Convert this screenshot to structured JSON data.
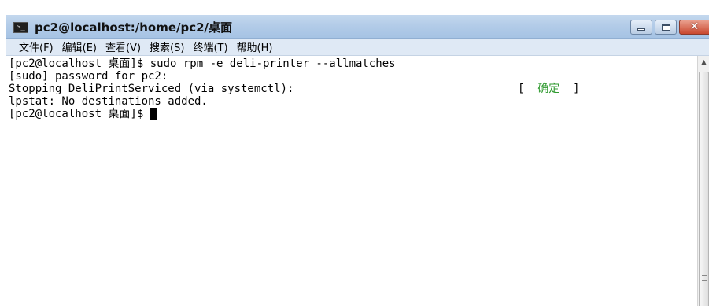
{
  "window": {
    "title": "pc2@localhost:/home/pc2/桌面",
    "icon": "terminal-icon",
    "controls": {
      "minimize": "minimize-icon",
      "maximize": "maximize-icon",
      "close": "close-icon",
      "close_glyph": "✕"
    }
  },
  "menubar": {
    "items": [
      {
        "label": "文件(F)"
      },
      {
        "label": "编辑(E)"
      },
      {
        "label": "查看(V)"
      },
      {
        "label": "搜索(S)"
      },
      {
        "label": "终端(T)"
      },
      {
        "label": "帮助(H)"
      }
    ]
  },
  "terminal": {
    "lines": [
      "[pc2@localhost 桌面]$ sudo rpm -e deli-printer --allmatches",
      "[sudo] password for pc2:",
      "Stopping DeliPrintServiced (via systemctl):",
      "lpstat: No destinations added.",
      "[pc2@localhost 桌面]$ "
    ],
    "status": {
      "open": "[ ",
      "text": " 确定 ",
      "close": " ]",
      "color": "#2f9a2f"
    }
  },
  "colors": {
    "titlebar": "#b3cce8",
    "menubar": "#dfe9f5",
    "close_button": "#c9482f"
  }
}
